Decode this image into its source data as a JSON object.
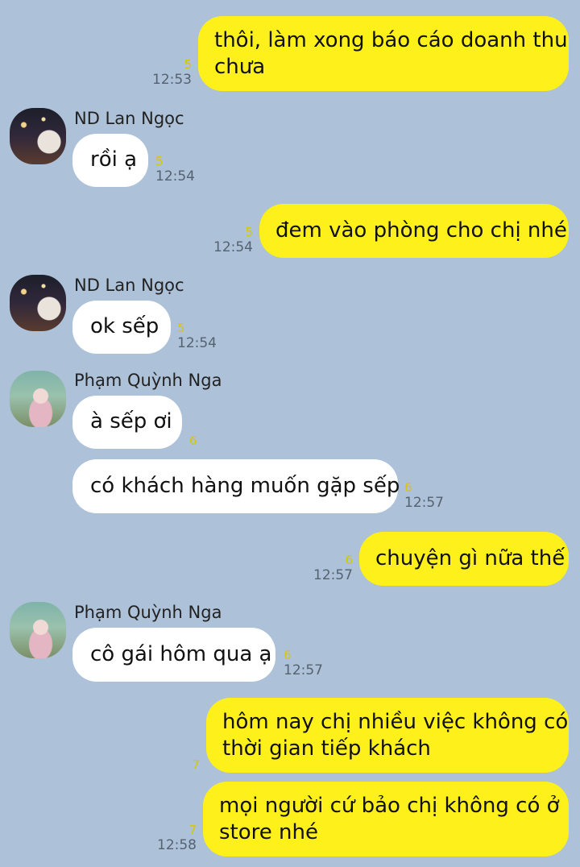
{
  "messages": [
    {
      "id": "m1",
      "side": "mine",
      "lines": [
        "thôi, làm xong báo cáo doanh thu",
        "chưa"
      ],
      "unread": "5",
      "time": "12:53"
    },
    {
      "id": "m2",
      "side": "theirs",
      "sender": "ND Lan Ngọc",
      "lines": [
        "rồi ạ"
      ],
      "unread": "5",
      "time": "12:54"
    },
    {
      "id": "m3",
      "side": "mine",
      "lines": [
        "đem vào phòng cho chị nhé"
      ],
      "unread": "5",
      "time": "12:54"
    },
    {
      "id": "m4",
      "side": "theirs",
      "sender": "ND Lan Ngọc",
      "lines": [
        "ok sếp"
      ],
      "unread": "5",
      "time": "12:54"
    },
    {
      "id": "m5",
      "side": "theirs",
      "sender": "Phạm Quỳnh Nga",
      "lines": [
        "à sếp ơi"
      ],
      "unread": "6",
      "time": ""
    },
    {
      "id": "m6",
      "side": "theirs",
      "lines": [
        "có khách hàng muốn gặp sếp"
      ],
      "unread": "6",
      "time": "12:57"
    },
    {
      "id": "m7",
      "side": "mine",
      "lines": [
        "chuyện gì nữa thế"
      ],
      "unread": "6",
      "time": "12:57"
    },
    {
      "id": "m8",
      "side": "theirs",
      "sender": "Phạm Quỳnh Nga",
      "lines": [
        "cô gái hôm qua ạ"
      ],
      "unread": "6",
      "time": "12:57"
    },
    {
      "id": "m9",
      "side": "mine",
      "lines": [
        "hôm nay chị nhiều việc không có",
        "thời gian tiếp khách"
      ],
      "unread": "7",
      "time": ""
    },
    {
      "id": "m10",
      "side": "mine",
      "lines": [
        "mọi người cứ bảo chị không có ở",
        "store nhé"
      ],
      "unread": "7",
      "time": "12:58"
    }
  ],
  "colors": {
    "background": "#adc1d8",
    "mine_bubble": "#fef01b",
    "their_bubble": "#ffffff",
    "unread": "#d6c800"
  }
}
